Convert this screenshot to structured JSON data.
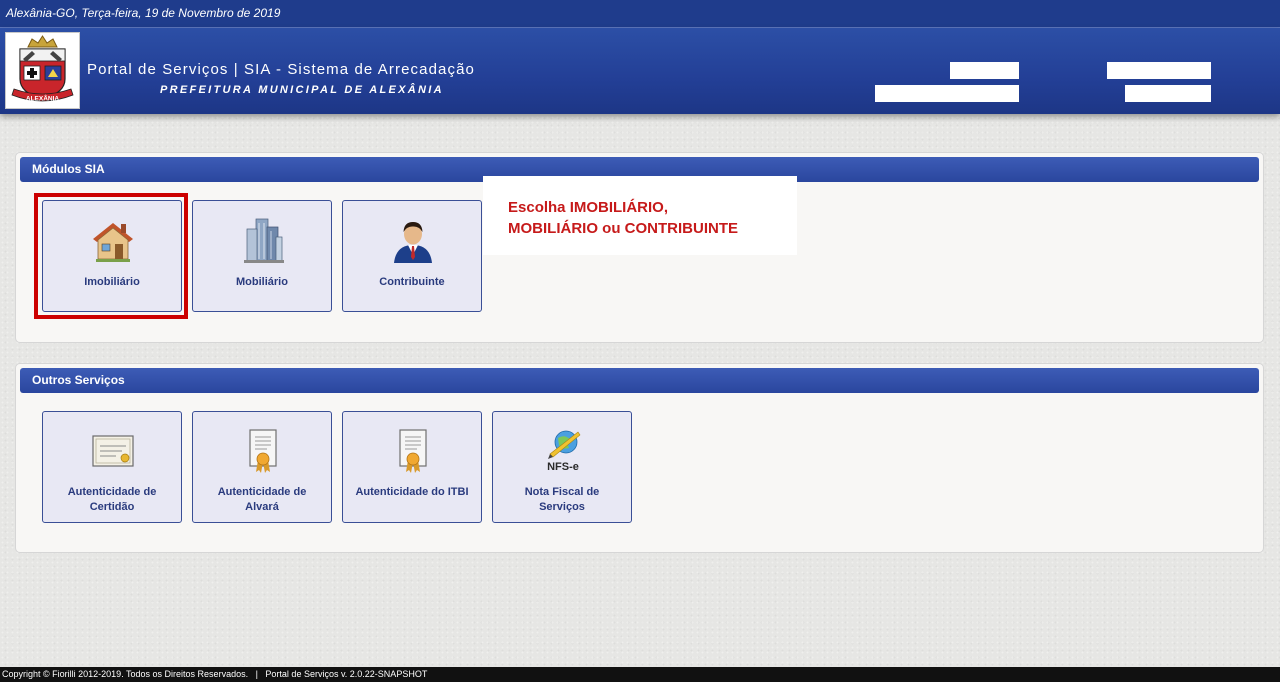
{
  "topbar": {
    "date_text": "Alexânia-GO, Terça-feira, 19 de Novembro de 2019"
  },
  "header": {
    "logo_icon": "municipal-coat-of-arms-icon",
    "logo_text": "ALEXÂNIA",
    "title": "Portal de Serviços | SIA - Sistema de Arrecadação",
    "subtitle": "PREFEITURA MUNICIPAL DE ALEXÂNIA"
  },
  "modulos": {
    "heading": "Módulos SIA",
    "tiles": [
      {
        "label": "Imobiliário",
        "icon": "house-icon"
      },
      {
        "label": "Mobiliário",
        "icon": "buildings-icon"
      },
      {
        "label": "Contribuinte",
        "icon": "businessman-icon"
      }
    ]
  },
  "callout": {
    "line1": "Escolha IMOBILIÁRIO,",
    "line2": "MOBILIÁRIO ou CONTRIBUINTE"
  },
  "outros": {
    "heading": "Outros Serviços",
    "tiles": [
      {
        "label_line1": "Autenticidade de",
        "label_line2": "Certidão",
        "icon": "certificate-icon"
      },
      {
        "label_line1": "Autenticidade de",
        "label_line2": "Alvará",
        "icon": "document-seal-icon"
      },
      {
        "label_line1": "Autenticidade do ITBI",
        "label_line2": "",
        "icon": "document-seal-icon"
      },
      {
        "label_line1": "Nota Fiscal de",
        "label_line2": "Serviços",
        "icon": "nfse-icon",
        "icon_text": "NFS-e"
      }
    ]
  },
  "footer": {
    "text": "Copyright © Fiorilli 2012-2019. Todos os Direitos Reservados.   |   Portal de Serviços v. 2.0.22-SNAPSHOT"
  },
  "colors": {
    "header_blue": "#233f96",
    "panel_head": "#2a469e",
    "tile_bg": "#e8e8f4",
    "highlight_red": "#cc0000",
    "callout_red": "#c61a1a"
  }
}
